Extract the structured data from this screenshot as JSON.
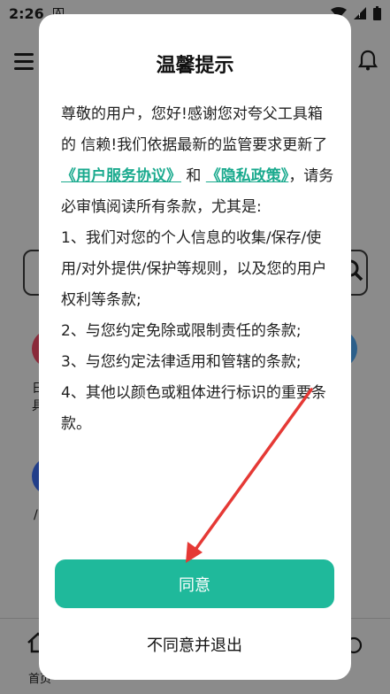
{
  "status_bar": {
    "time": "2:26",
    "app_icon": "A",
    "wifi_icon": "wifi-icon",
    "signal_icon": "signal-icon",
    "battery_icon": "battery-icon"
  },
  "background": {
    "bg_text_1": "日",
    "bg_text_2": "具",
    "bg_text_3": "/",
    "nav_home_label": "首页"
  },
  "dialog": {
    "title": "温馨提示",
    "intro_1": "尊敬的用户，您好!感谢您对夸父工具箱的 信赖!我们依据最新的监管要求更新了",
    "link_agreement": "《用户服务协议》",
    "and": "和",
    "link_privacy": "《隐私政策》",
    "intro_2": "，请务 必审慎阅读所有条款，尤其是:",
    "item_1": " 1、我们对您的个人信息的收集/保存/使 用/对外提供/保护等规则，以及您的用户 权利等条款;",
    "item_2": " 2、与您约定免除或限制责任的条款;",
    "item_3": " 3、与您约定法律适用和管辖的条款;",
    "item_4": " 4、其他以颜色或粗体进行标识的重要条 款。",
    "agree_label": "同意",
    "disagree_label": "不同意并退出"
  },
  "colors": {
    "accent": "#1fb99b",
    "link": "#1aaa8e",
    "arrow": "#e53935",
    "overlay": "#8b8b8b"
  }
}
